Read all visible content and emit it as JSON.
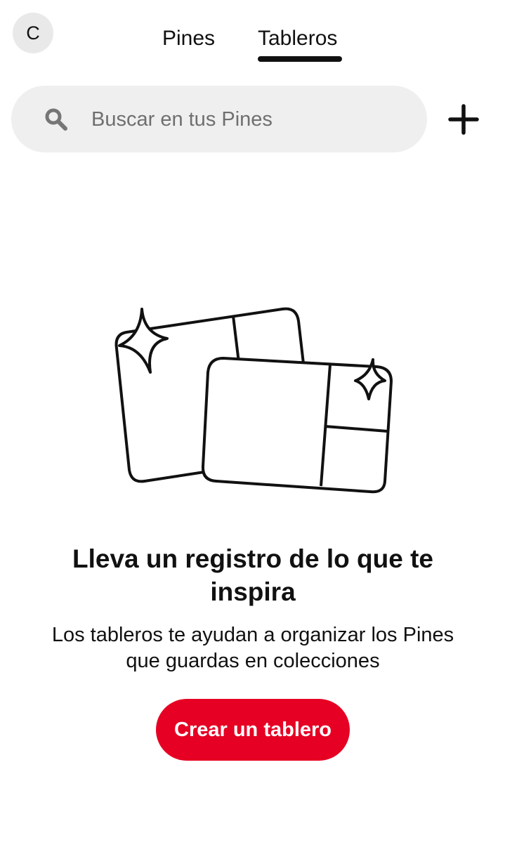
{
  "header": {
    "avatar_initial": "C",
    "tabs": [
      {
        "label": "Pines",
        "active": false
      },
      {
        "label": "Tableros",
        "active": true
      }
    ]
  },
  "search": {
    "placeholder": "Buscar en tus Pines",
    "value": ""
  },
  "icons": {
    "search": "search-icon",
    "add": "plus-icon",
    "illustration": "boards-sparkle-illustration"
  },
  "empty_state": {
    "heading": "Lleva un registro de lo que te inspira",
    "description": "Los tableros te ayudan a organizar los Pines que guardas en colecciones",
    "button_label": "Crear un tablero"
  },
  "colors": {
    "accent": "#e60023",
    "text": "#111111",
    "search_bg": "#efefef",
    "avatar_bg": "#e9e9e9"
  }
}
